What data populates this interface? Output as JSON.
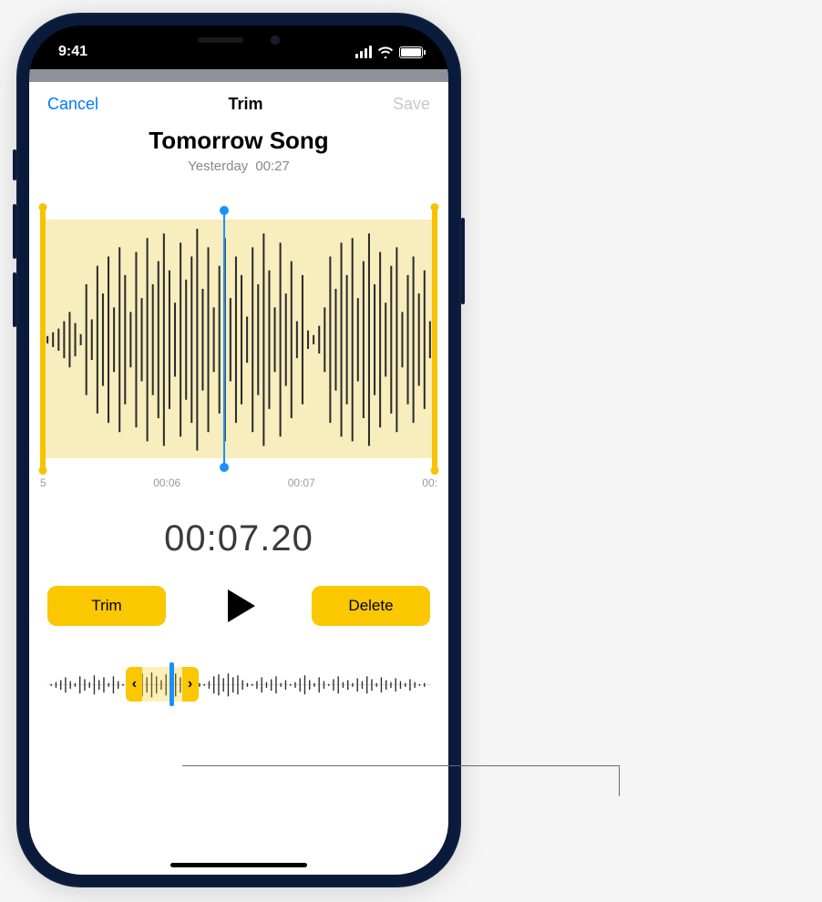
{
  "status": {
    "time": "9:41"
  },
  "nav": {
    "cancel": "Cancel",
    "title": "Trim",
    "save": "Save"
  },
  "recording": {
    "title": "Tomorrow Song",
    "date": "Yesterday",
    "duration": "00:27"
  },
  "timeline": {
    "ticks": [
      "5",
      "00:06",
      "00:07",
      "00:"
    ],
    "current_time": "00:07.20"
  },
  "controls": {
    "trim": "Trim",
    "delete": "Delete"
  },
  "mini": {
    "left_chevron": "‹",
    "right_chevron": "›"
  },
  "colors": {
    "accent_blue": "#007aff",
    "action_yellow": "#fac700",
    "highlight_bg": "#f7edbd",
    "playhead_blue": "#1a8fff"
  }
}
